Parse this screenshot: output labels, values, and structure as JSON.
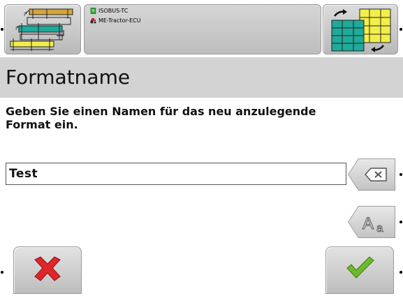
{
  "status": {
    "line1": "ISOBUS-TC",
    "line2": "ME-Tractor-ECU",
    "line1_icon": "document-icon",
    "line2_icon": "tractor-icon"
  },
  "title": "Formatname",
  "prompt": "Geben Sie einen Namen für das neu anzulegende Format ein.",
  "input": {
    "value": "Test"
  },
  "softkeys": {
    "top_left": "format-layout-icon",
    "top_right": "swap-layout-icon",
    "clear": "backspace-icon",
    "case": "text-case-icon",
    "cancel": "cancel-icon",
    "confirm": "confirm-icon"
  },
  "colors": {
    "cancel": "#e0252b",
    "confirm": "#6dbb2a",
    "title_bg": "#d3d3d3"
  }
}
